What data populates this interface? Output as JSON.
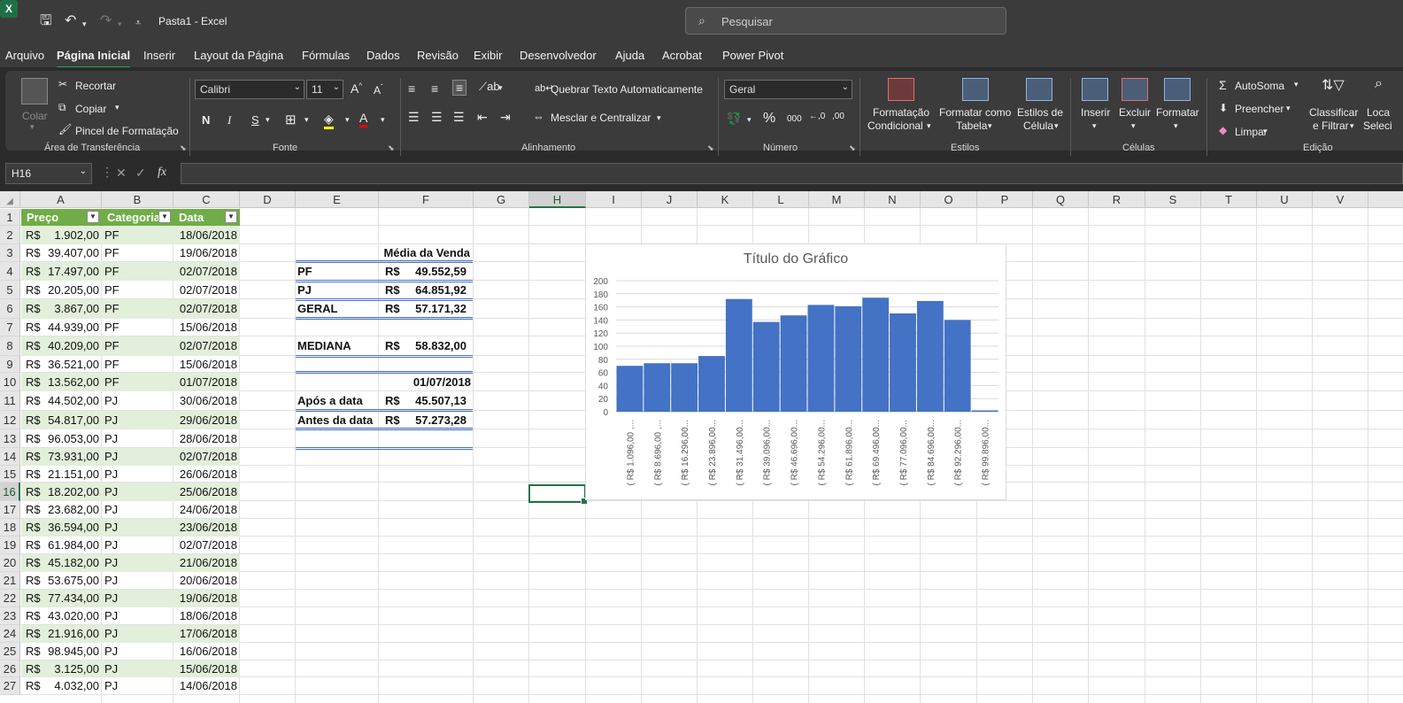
{
  "window": {
    "title": "Pasta1  -  Excel",
    "search_placeholder": "Pesquisar"
  },
  "menu": [
    "Arquivo",
    "Página Inicial",
    "Inserir",
    "Layout da Página",
    "Fórmulas",
    "Dados",
    "Revisão",
    "Exibir",
    "Desenvolvedor",
    "Ajuda",
    "Acrobat",
    "Power Pivot"
  ],
  "ribbon": {
    "clipboard": {
      "paste": "Colar",
      "cut": "Recortar",
      "copy": "Copiar",
      "format_painter": "Pincel de Formatação",
      "group": "Área de Transferência"
    },
    "font": {
      "name": "Calibri",
      "size": "11",
      "bold": "N",
      "italic": "I",
      "underline": "S",
      "group": "Fonte"
    },
    "alignment": {
      "wrap": "Quebrar Texto Automaticamente",
      "merge": "Mesclar e Centralizar",
      "group": "Alinhamento"
    },
    "number": {
      "format": "Geral",
      "percent": "%",
      "thousands": "000",
      "group": "Número"
    },
    "styles": {
      "conditional_1": "Formatação",
      "conditional_2": "Condicional",
      "table_1": "Formatar como",
      "table_2": "Tabela",
      "cell_1": "Estilos de",
      "cell_2": "Célula",
      "group": "Estilos"
    },
    "cells": {
      "insert": "Inserir",
      "delete": "Excluir",
      "format": "Formatar",
      "group": "Células"
    },
    "editing": {
      "autosum": "AutoSoma",
      "fill": "Preencher",
      "clear": "Limpar",
      "sort_1": "Classificar",
      "sort_2": "e Filtrar",
      "find_1": "Loca",
      "find_2": "Seleci",
      "group": "Edição"
    }
  },
  "formula_bar": {
    "name_box": "H16",
    "fx": "fx",
    "formula": ""
  },
  "columns": [
    "A",
    "B",
    "C",
    "D",
    "E",
    "F",
    "G",
    "H",
    "I",
    "J",
    "K",
    "L",
    "M",
    "N",
    "O",
    "P",
    "Q",
    "R",
    "S",
    "T",
    "U",
    "V"
  ],
  "table": {
    "headers": [
      "Preço",
      "Categoria",
      "Data"
    ],
    "rows": [
      [
        "R$",
        "1.902,00",
        "PF",
        "18/06/2018"
      ],
      [
        "R$",
        "39.407,00",
        "PF",
        "19/06/2018"
      ],
      [
        "R$",
        "17.497,00",
        "PF",
        "02/07/2018"
      ],
      [
        "R$",
        "20.205,00",
        "PF",
        "02/07/2018"
      ],
      [
        "R$",
        "3.867,00",
        "PF",
        "02/07/2018"
      ],
      [
        "R$",
        "44.939,00",
        "PF",
        "15/06/2018"
      ],
      [
        "R$",
        "40.209,00",
        "PF",
        "02/07/2018"
      ],
      [
        "R$",
        "36.521,00",
        "PF",
        "15/06/2018"
      ],
      [
        "R$",
        "13.562,00",
        "PF",
        "01/07/2018"
      ],
      [
        "R$",
        "44.502,00",
        "PJ",
        "30/06/2018"
      ],
      [
        "R$",
        "54.817,00",
        "PJ",
        "29/06/2018"
      ],
      [
        "R$",
        "96.053,00",
        "PJ",
        "28/06/2018"
      ],
      [
        "R$",
        "73.931,00",
        "PJ",
        "02/07/2018"
      ],
      [
        "R$",
        "21.151,00",
        "PJ",
        "26/06/2018"
      ],
      [
        "R$",
        "18.202,00",
        "PJ",
        "25/06/2018"
      ],
      [
        "R$",
        "23.682,00",
        "PJ",
        "24/06/2018"
      ],
      [
        "R$",
        "36.594,00",
        "PJ",
        "23/06/2018"
      ],
      [
        "R$",
        "61.984,00",
        "PJ",
        "02/07/2018"
      ],
      [
        "R$",
        "45.182,00",
        "PJ",
        "21/06/2018"
      ],
      [
        "R$",
        "53.675,00",
        "PJ",
        "20/06/2018"
      ],
      [
        "R$",
        "77.434,00",
        "PJ",
        "19/06/2018"
      ],
      [
        "R$",
        "43.020,00",
        "PJ",
        "18/06/2018"
      ],
      [
        "R$",
        "21.916,00",
        "PJ",
        "17/06/2018"
      ],
      [
        "R$",
        "98.945,00",
        "PJ",
        "16/06/2018"
      ],
      [
        "R$",
        "3.125,00",
        "PJ",
        "15/06/2018"
      ],
      [
        "R$",
        "4.032,00",
        "PJ",
        "14/06/2018"
      ]
    ]
  },
  "summary": {
    "title": "Média da Venda",
    "pf": [
      "PF",
      "R$",
      "49.552,59"
    ],
    "pj": [
      "PJ",
      "R$",
      "64.851,92"
    ],
    "geral": [
      "GERAL",
      "R$",
      "57.171,32"
    ],
    "mediana": [
      "MEDIANA",
      "R$",
      "58.832,00"
    ],
    "date": "01/07/2018",
    "after": [
      "Após a data",
      "R$",
      "45.507,13"
    ],
    "before": [
      "Antes da data",
      "R$",
      "57.273,28"
    ]
  },
  "chart_data": {
    "type": "bar",
    "title": "Título do Gráfico",
    "categories": [
      "( R$ 1.096,00 ,...",
      "( R$ 8.696,00 ,...",
      "( R$ 16.296,00...",
      "( R$ 23.896,00...",
      "( R$ 31.496,00...",
      "( R$ 39.096,00...",
      "( R$ 46.696,00...",
      "( R$ 54.296,00...",
      "( R$ 61.896,00...",
      "( R$ 69.496,00...",
      "( R$ 77.096,00...",
      "( R$ 84.696,00...",
      "( R$ 92.296,00...",
      "( R$ 99.896,00..."
    ],
    "values": [
      70,
      74,
      74,
      85,
      172,
      137,
      147,
      163,
      161,
      174,
      150,
      169,
      140,
      2
    ],
    "ylim": [
      0,
      200
    ],
    "yticks": [
      "0",
      "20",
      "40",
      "60",
      "80",
      "100",
      "120",
      "140",
      "160",
      "180",
      "200"
    ],
    "grid": true,
    "color": "#4472c4"
  }
}
